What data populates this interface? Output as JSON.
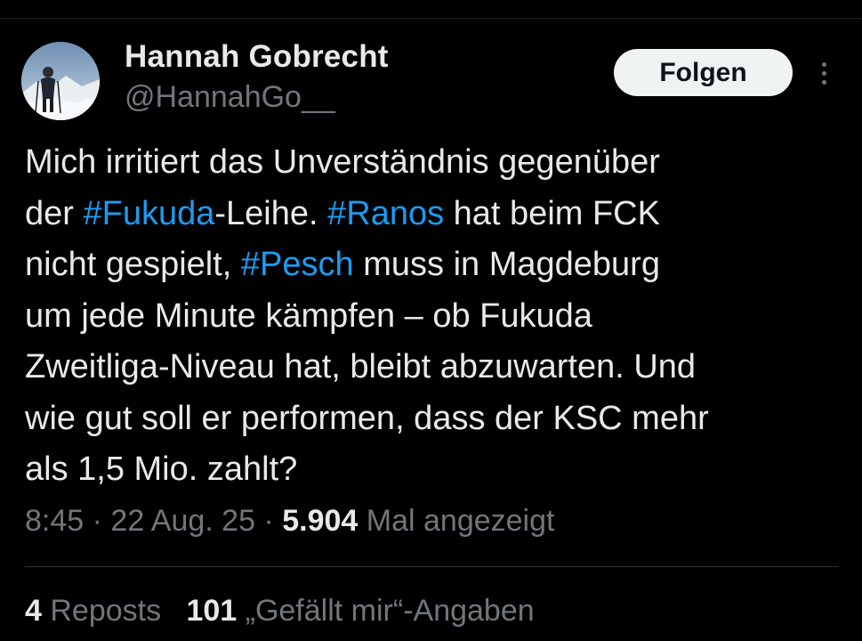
{
  "author": {
    "display_name": "Hannah Gobrecht",
    "handle": "@HannahGo__",
    "avatar": "profile-photo-snowy-mountain"
  },
  "actions": {
    "follow_label": "Folgen",
    "more_icon": "more-vertical-icon"
  },
  "tweet": {
    "lines": [
      [
        {
          "t": "Mich irritiert das Unverständnis gegenüber"
        }
      ],
      [
        {
          "t": "der "
        },
        {
          "t": "#Fukuda",
          "tag": true
        },
        {
          "t": "-Leihe. "
        },
        {
          "t": "#Ranos",
          "tag": true
        },
        {
          "t": " hat beim FCK"
        }
      ],
      [
        {
          "t": "nicht gespielt, "
        },
        {
          "t": "#Pesch",
          "tag": true
        },
        {
          "t": " muss in Magdeburg"
        }
      ],
      [
        {
          "t": "um jede Minute kämpfen – ob Fukuda"
        }
      ],
      [
        {
          "t": "Zweitliga-Niveau hat, bleibt abzuwarten. Und"
        }
      ],
      [
        {
          "t": "wie gut soll er performen, dass der KSC mehr"
        }
      ],
      [
        {
          "t": "als 1,5 Mio. zahlt?"
        }
      ]
    ]
  },
  "meta": {
    "time": "8:45",
    "separator": " · ",
    "date": "22 Aug. 25",
    "views_count": "5.904",
    "views_label": " Mal angezeigt"
  },
  "stats": {
    "reposts_count": "4",
    "reposts_label": " Reposts",
    "likes_count": "101",
    "likes_label": " „Gefällt mir“-Angaben"
  },
  "colors": {
    "background": "#000000",
    "text_primary": "#e7e9ea",
    "text_secondary": "#71767b",
    "hashtag": "#1d9bf0",
    "follow_button_bg": "#eff3f4",
    "divider": "#2f3336"
  }
}
